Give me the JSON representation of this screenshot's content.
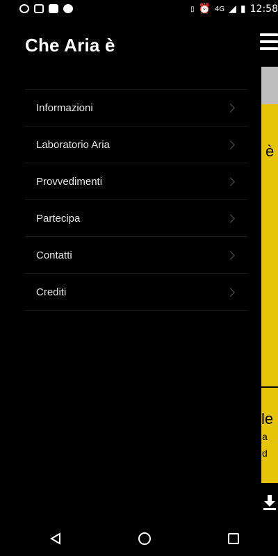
{
  "status_bar": {
    "time": "12:58",
    "network": "4G",
    "left_icons": [
      "whatsapp-icon",
      "gmail-icon",
      "image-icon",
      "alarm-icon"
    ],
    "right_icons": [
      "vibrate-icon",
      "alarm-icon",
      "signal-icon",
      "battery-icon"
    ]
  },
  "drawer": {
    "title": "Che Aria è",
    "items": [
      {
        "label": "Informazioni"
      },
      {
        "label": "Laboratorio Aria"
      },
      {
        "label": "Provvedimenti"
      },
      {
        "label": "Partecipa"
      },
      {
        "label": "Contatti"
      },
      {
        "label": "Crediti"
      }
    ]
  },
  "background_content": {
    "peek_char_1": "è",
    "peek_char_2": "le",
    "peek_char_3": "a",
    "peek_char_4": "d",
    "colors": {
      "accent": "#e6c40a",
      "grey": "#bdbdbd"
    }
  },
  "nav_bar": {
    "icons": [
      "back-icon",
      "home-icon",
      "recents-icon"
    ]
  }
}
